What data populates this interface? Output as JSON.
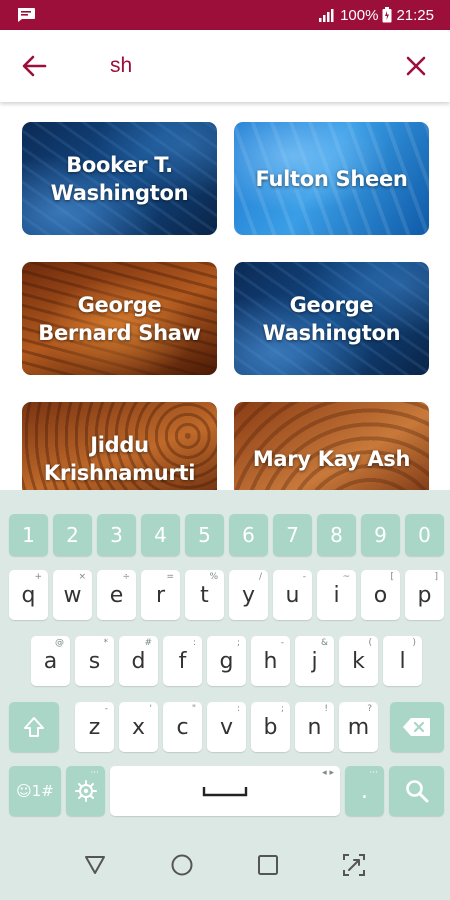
{
  "status_bar": {
    "battery": "100%",
    "time": "21:25",
    "icons": [
      "message-icon",
      "signal-icon",
      "battery-icon"
    ]
  },
  "search": {
    "query": "sh",
    "back_icon": "arrow-left-icon",
    "clear_icon": "close-icon"
  },
  "results": [
    {
      "title": "Booker T. Washington",
      "background": "blue-dark"
    },
    {
      "title": "Fulton Sheen",
      "background": "blue-light"
    },
    {
      "title": "George Bernard Shaw",
      "background": "wood-dark"
    },
    {
      "title": "George Washington",
      "background": "blue-dark"
    },
    {
      "title": "Jiddu Krishnamurti",
      "background": "wood-rings"
    },
    {
      "title": "Mary Kay Ash",
      "background": "wood-grain"
    }
  ],
  "keyboard": {
    "number_row": [
      "1",
      "2",
      "3",
      "4",
      "5",
      "6",
      "7",
      "8",
      "9",
      "0"
    ],
    "row1": [
      {
        "key": "q",
        "hint": "+"
      },
      {
        "key": "w",
        "hint": "×"
      },
      {
        "key": "e",
        "hint": "÷"
      },
      {
        "key": "r",
        "hint": "="
      },
      {
        "key": "t",
        "hint": "%"
      },
      {
        "key": "y",
        "hint": "/"
      },
      {
        "key": "u",
        "hint": "-"
      },
      {
        "key": "i",
        "hint": "~"
      },
      {
        "key": "o",
        "hint": "["
      },
      {
        "key": "p",
        "hint": "]"
      }
    ],
    "row2": [
      {
        "key": "a",
        "hint": "@"
      },
      {
        "key": "s",
        "hint": "*"
      },
      {
        "key": "d",
        "hint": "#"
      },
      {
        "key": "f",
        "hint": ":"
      },
      {
        "key": "g",
        "hint": ";"
      },
      {
        "key": "h",
        "hint": "-"
      },
      {
        "key": "j",
        "hint": "&"
      },
      {
        "key": "k",
        "hint": "("
      },
      {
        "key": "l",
        "hint": ")"
      }
    ],
    "row3": [
      {
        "key": "z",
        "hint": "-"
      },
      {
        "key": "x",
        "hint": "'"
      },
      {
        "key": "c",
        "hint": "\""
      },
      {
        "key": "v",
        "hint": ":"
      },
      {
        "key": "b",
        "hint": ";"
      },
      {
        "key": "n",
        "hint": "!"
      },
      {
        "key": "m",
        "hint": "?"
      }
    ],
    "symbols_label": "☺1#",
    "period": ".",
    "period_hint": "···",
    "space_hints": "◂ ▸",
    "icons": [
      "shift-icon",
      "backspace-icon",
      "settings-icon",
      "space-icon",
      "search-icon"
    ]
  },
  "nav_bar": {
    "icons": [
      "back-triangle-icon",
      "home-circle-icon",
      "recents-square-icon",
      "screen-rotate-icon"
    ]
  },
  "colors": {
    "brand": "#9b0f3a",
    "key_accent": "#a9d6c7",
    "keyboard_bg": "#dbe8e3"
  }
}
